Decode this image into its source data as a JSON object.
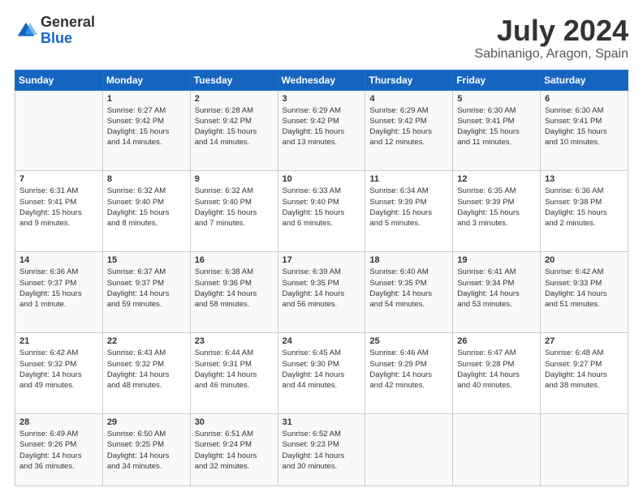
{
  "header": {
    "logo_general": "General",
    "logo_blue": "Blue",
    "main_title": "July 2024",
    "subtitle": "Sabinanigo, Aragon, Spain"
  },
  "calendar": {
    "days": [
      "Sunday",
      "Monday",
      "Tuesday",
      "Wednesday",
      "Thursday",
      "Friday",
      "Saturday"
    ],
    "weeks": [
      [
        {
          "num": "",
          "lines": []
        },
        {
          "num": "1",
          "lines": [
            "Sunrise: 6:27 AM",
            "Sunset: 9:42 PM",
            "Daylight: 15 hours",
            "and 14 minutes."
          ]
        },
        {
          "num": "2",
          "lines": [
            "Sunrise: 6:28 AM",
            "Sunset: 9:42 PM",
            "Daylight: 15 hours",
            "and 14 minutes."
          ]
        },
        {
          "num": "3",
          "lines": [
            "Sunrise: 6:29 AM",
            "Sunset: 9:42 PM",
            "Daylight: 15 hours",
            "and 13 minutes."
          ]
        },
        {
          "num": "4",
          "lines": [
            "Sunrise: 6:29 AM",
            "Sunset: 9:42 PM",
            "Daylight: 15 hours",
            "and 12 minutes."
          ]
        },
        {
          "num": "5",
          "lines": [
            "Sunrise: 6:30 AM",
            "Sunset: 9:41 PM",
            "Daylight: 15 hours",
            "and 11 minutes."
          ]
        },
        {
          "num": "6",
          "lines": [
            "Sunrise: 6:30 AM",
            "Sunset: 9:41 PM",
            "Daylight: 15 hours",
            "and 10 minutes."
          ]
        }
      ],
      [
        {
          "num": "7",
          "lines": [
            "Sunrise: 6:31 AM",
            "Sunset: 9:41 PM",
            "Daylight: 15 hours",
            "and 9 minutes."
          ]
        },
        {
          "num": "8",
          "lines": [
            "Sunrise: 6:32 AM",
            "Sunset: 9:40 PM",
            "Daylight: 15 hours",
            "and 8 minutes."
          ]
        },
        {
          "num": "9",
          "lines": [
            "Sunrise: 6:32 AM",
            "Sunset: 9:40 PM",
            "Daylight: 15 hours",
            "and 7 minutes."
          ]
        },
        {
          "num": "10",
          "lines": [
            "Sunrise: 6:33 AM",
            "Sunset: 9:40 PM",
            "Daylight: 15 hours",
            "and 6 minutes."
          ]
        },
        {
          "num": "11",
          "lines": [
            "Sunrise: 6:34 AM",
            "Sunset: 9:39 PM",
            "Daylight: 15 hours",
            "and 5 minutes."
          ]
        },
        {
          "num": "12",
          "lines": [
            "Sunrise: 6:35 AM",
            "Sunset: 9:39 PM",
            "Daylight: 15 hours",
            "and 3 minutes."
          ]
        },
        {
          "num": "13",
          "lines": [
            "Sunrise: 6:36 AM",
            "Sunset: 9:38 PM",
            "Daylight: 15 hours",
            "and 2 minutes."
          ]
        }
      ],
      [
        {
          "num": "14",
          "lines": [
            "Sunrise: 6:36 AM",
            "Sunset: 9:37 PM",
            "Daylight: 15 hours",
            "and 1 minute."
          ]
        },
        {
          "num": "15",
          "lines": [
            "Sunrise: 6:37 AM",
            "Sunset: 9:37 PM",
            "Daylight: 14 hours",
            "and 59 minutes."
          ]
        },
        {
          "num": "16",
          "lines": [
            "Sunrise: 6:38 AM",
            "Sunset: 9:36 PM",
            "Daylight: 14 hours",
            "and 58 minutes."
          ]
        },
        {
          "num": "17",
          "lines": [
            "Sunrise: 6:39 AM",
            "Sunset: 9:35 PM",
            "Daylight: 14 hours",
            "and 56 minutes."
          ]
        },
        {
          "num": "18",
          "lines": [
            "Sunrise: 6:40 AM",
            "Sunset: 9:35 PM",
            "Daylight: 14 hours",
            "and 54 minutes."
          ]
        },
        {
          "num": "19",
          "lines": [
            "Sunrise: 6:41 AM",
            "Sunset: 9:34 PM",
            "Daylight: 14 hours",
            "and 53 minutes."
          ]
        },
        {
          "num": "20",
          "lines": [
            "Sunrise: 6:42 AM",
            "Sunset: 9:33 PM",
            "Daylight: 14 hours",
            "and 51 minutes."
          ]
        }
      ],
      [
        {
          "num": "21",
          "lines": [
            "Sunrise: 6:42 AM",
            "Sunset: 9:32 PM",
            "Daylight: 14 hours",
            "and 49 minutes."
          ]
        },
        {
          "num": "22",
          "lines": [
            "Sunrise: 6:43 AM",
            "Sunset: 9:32 PM",
            "Daylight: 14 hours",
            "and 48 minutes."
          ]
        },
        {
          "num": "23",
          "lines": [
            "Sunrise: 6:44 AM",
            "Sunset: 9:31 PM",
            "Daylight: 14 hours",
            "and 46 minutes."
          ]
        },
        {
          "num": "24",
          "lines": [
            "Sunrise: 6:45 AM",
            "Sunset: 9:30 PM",
            "Daylight: 14 hours",
            "and 44 minutes."
          ]
        },
        {
          "num": "25",
          "lines": [
            "Sunrise: 6:46 AM",
            "Sunset: 9:29 PM",
            "Daylight: 14 hours",
            "and 42 minutes."
          ]
        },
        {
          "num": "26",
          "lines": [
            "Sunrise: 6:47 AM",
            "Sunset: 9:28 PM",
            "Daylight: 14 hours",
            "and 40 minutes."
          ]
        },
        {
          "num": "27",
          "lines": [
            "Sunrise: 6:48 AM",
            "Sunset: 9:27 PM",
            "Daylight: 14 hours",
            "and 38 minutes."
          ]
        }
      ],
      [
        {
          "num": "28",
          "lines": [
            "Sunrise: 6:49 AM",
            "Sunset: 9:26 PM",
            "Daylight: 14 hours",
            "and 36 minutes."
          ]
        },
        {
          "num": "29",
          "lines": [
            "Sunrise: 6:50 AM",
            "Sunset: 9:25 PM",
            "Daylight: 14 hours",
            "and 34 minutes."
          ]
        },
        {
          "num": "30",
          "lines": [
            "Sunrise: 6:51 AM",
            "Sunset: 9:24 PM",
            "Daylight: 14 hours",
            "and 32 minutes."
          ]
        },
        {
          "num": "31",
          "lines": [
            "Sunrise: 6:52 AM",
            "Sunset: 9:23 PM",
            "Daylight: 14 hours",
            "and 30 minutes."
          ]
        },
        {
          "num": "",
          "lines": []
        },
        {
          "num": "",
          "lines": []
        },
        {
          "num": "",
          "lines": []
        }
      ]
    ]
  }
}
